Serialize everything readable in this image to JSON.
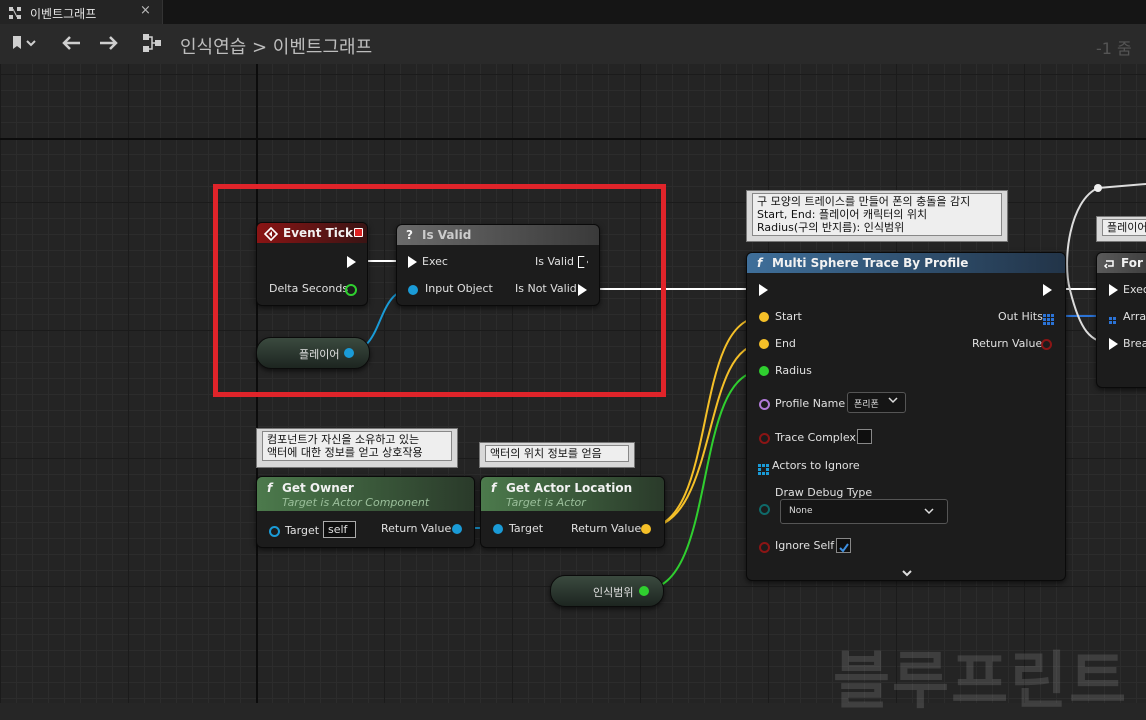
{
  "tab": {
    "title": "이벤트그래프",
    "close": "×"
  },
  "toolbar": {
    "breadcrumb": "인식연습 > 이벤트그래프",
    "zoom": "-1 줌"
  },
  "comments": {
    "trace": [
      "구 모양의 트레이스를 만들어 폰의 충돌을 감지",
      "Start, End: 플레이어 캐릭터의 위치",
      "Radius(구의 반지름): 인식범위"
    ],
    "owner": [
      "컴포넌트가 자신을 소유하고 있는",
      "액터에 대한 정보를 얻고 상호작용"
    ],
    "location": "액터의 위치 정보를 얻음",
    "foreach": "플레이어"
  },
  "nodes": {
    "event_tick": {
      "title": "Event Tick",
      "delta": "Delta Seconds"
    },
    "is_valid": {
      "title": "Is Valid",
      "exec": "Exec",
      "input": "Input Object",
      "is_valid": "Is Valid",
      "not_valid": "Is Not Valid"
    },
    "player_var": {
      "label": "플레이어"
    },
    "get_owner": {
      "title": "Get Owner",
      "subtitle": "Target is Actor Component",
      "target": "Target",
      "target_value": "self",
      "ret": "Return Value"
    },
    "get_loc": {
      "title": "Get Actor Location",
      "subtitle": "Target is Actor",
      "target": "Target",
      "ret": "Return Value"
    },
    "range_var": {
      "label": "인식범위"
    },
    "trace": {
      "title": "Multi Sphere Trace By Profile",
      "start": "Start",
      "end": "End",
      "radius": "Radius",
      "profile": "Profile Name",
      "profile_value": "폰리폰",
      "complex": "Trace Complex",
      "ignore": "Actors to Ignore",
      "debug": "Draw Debug Type",
      "debug_value": "None",
      "ignore_self": "Ignore Self",
      "out_hits": "Out Hits",
      "ret": "Return Value"
    },
    "foreach": {
      "title": "For E",
      "exec": "Exec",
      "array": "Array",
      "brk": "Brea"
    }
  },
  "colors": {
    "exec": "#ffffff",
    "object": "#1a9bd7",
    "vector": "#f5c028",
    "float": "#2fcf2f",
    "bool": "#8b1515",
    "name": "#b07ad8",
    "struct": "#2b73d6",
    "highlight": "#e0242a"
  },
  "watermark": "블루프린트"
}
